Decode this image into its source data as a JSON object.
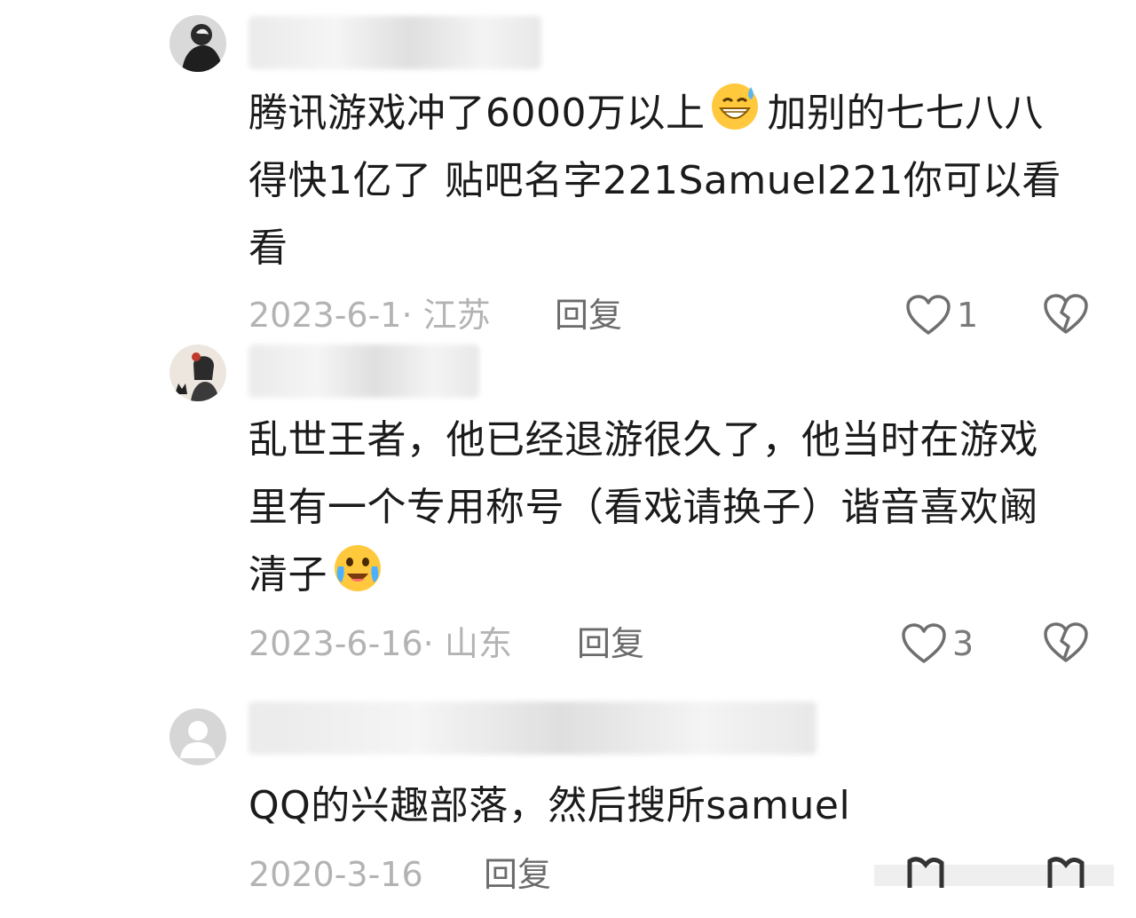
{
  "comments": [
    {
      "lines": [
        "腾讯游戏冲了6000万以上",
        "加别的七七八八",
        "得快1亿了 贴吧名字221Samuel221你可以看",
        "看"
      ],
      "emoji": "grinning-sweat-emoji",
      "date_location": "2023-6-1· 江苏",
      "reply_label": "回复",
      "like_count": "1"
    },
    {
      "lines": [
        "乱世王者，他已经退游很久了，他当时在游戏",
        "里有一个专用称号（看戏请换子）谐音喜欢阚",
        "清子"
      ],
      "emoji": "crying-laugh-emoji",
      "date_location": "2023-6-16· 山东",
      "reply_label": "回复",
      "like_count": "3"
    },
    {
      "lines": [
        "QQ的兴趣部落，然后搜所samuel"
      ],
      "date_location": "2020-3-16",
      "reply_label": "回复"
    }
  ],
  "icons": {
    "like": "heart-outline-icon",
    "dislike": "broken-heart-icon",
    "default_avatar": "default-user-icon"
  },
  "colors": {
    "text": "#1b1b1b",
    "meta": "#b3b3b3",
    "reply": "#6b6b6b",
    "icon": "#6f6f6f"
  }
}
